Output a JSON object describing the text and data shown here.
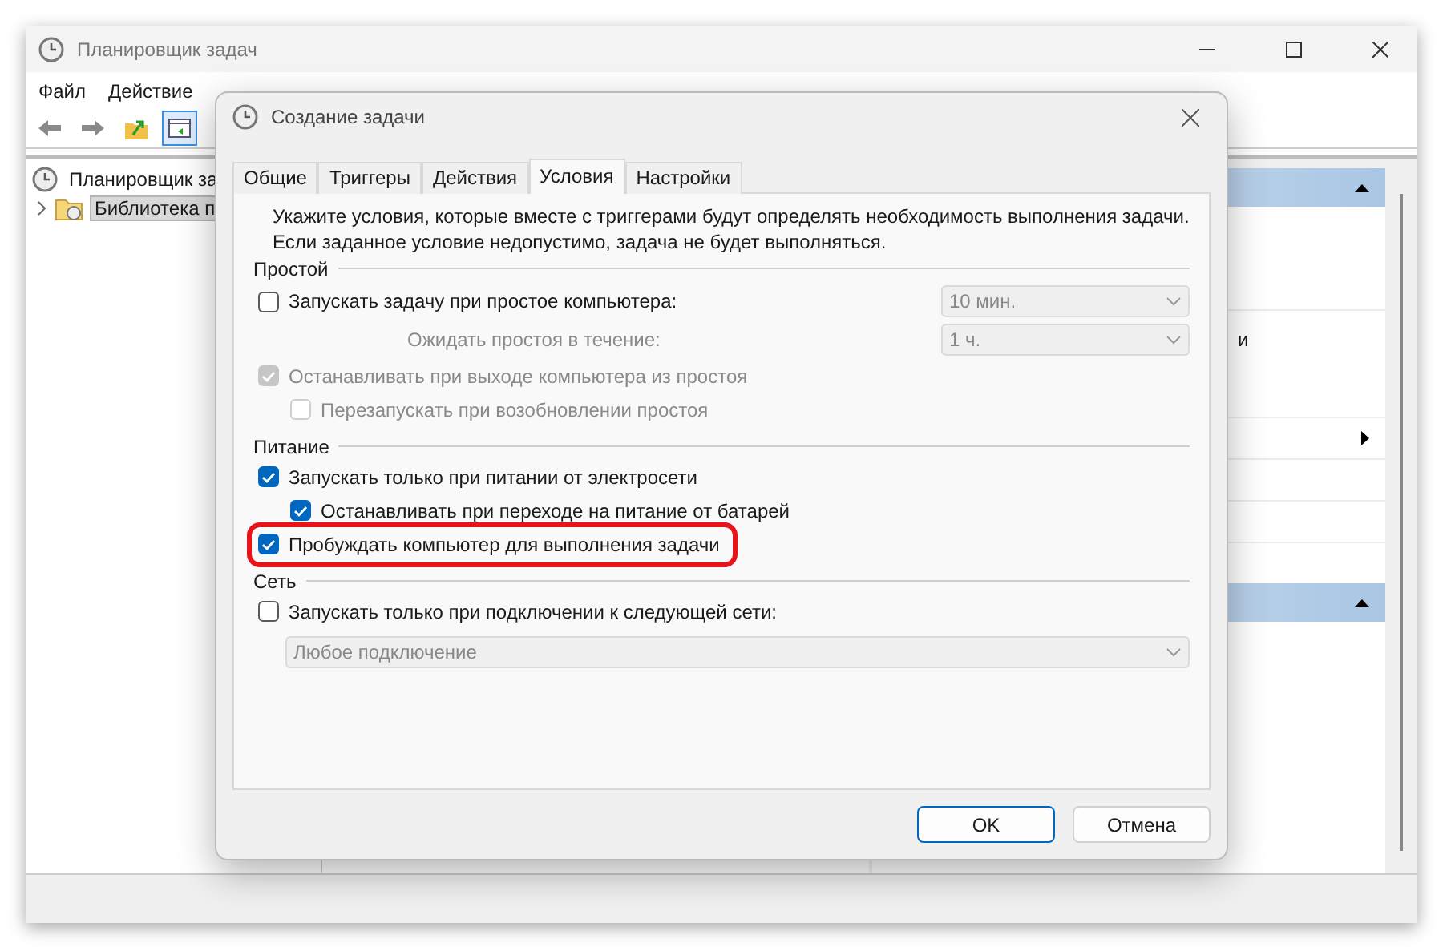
{
  "main_window": {
    "title": "Планировщик задач",
    "menu": [
      "Файл",
      "Действие"
    ],
    "tree": [
      {
        "label": "Планировщик за",
        "selected": false,
        "children": [
          {
            "label": "Библиотека п",
            "expanded": false,
            "selected": true
          }
        ]
      }
    ],
    "actions_fragment": "и"
  },
  "dialog": {
    "title": "Создание задачи",
    "tabs": [
      {
        "label": "Общие",
        "selected": false
      },
      {
        "label": "Триггеры",
        "selected": false
      },
      {
        "label": "Действия",
        "selected": false
      },
      {
        "label": "Условия",
        "selected": true
      },
      {
        "label": "Настройки",
        "selected": false
      }
    ],
    "description": "Укажите условия, которые вместе с триггерами будут определять необходимость выполнения задачи. Если заданное условие недопустимо, задача не будет выполняться.",
    "sections": [
      {
        "title": "Простой",
        "items": [
          {
            "kind": "checkbox",
            "label": "Запускать задачу при простое компьютера:",
            "checked": false,
            "disabled": false,
            "highlighted": false,
            "combo": {
              "value": "10 мин.",
              "disabled": true
            }
          },
          {
            "kind": "label",
            "label": "Ожидать простоя в течение:",
            "disabled": true,
            "combo": {
              "value": "1 ч.",
              "disabled": true
            }
          },
          {
            "kind": "checkbox",
            "label": "Останавливать при выходе компьютера из простоя",
            "checked": true,
            "disabled": true,
            "highlighted": false,
            "children": [
              {
                "kind": "checkbox",
                "label": "Перезапускать при возобновлении простоя",
                "checked": false,
                "disabled": true,
                "highlighted": false
              }
            ]
          }
        ]
      },
      {
        "title": "Питание",
        "items": [
          {
            "kind": "checkbox",
            "label": "Запускать только при питании от электросети",
            "checked": true,
            "disabled": false,
            "highlighted": false,
            "children": [
              {
                "kind": "checkbox",
                "label": "Останавливать при переходе на питание от батарей",
                "checked": true,
                "disabled": false,
                "highlighted": false
              }
            ]
          },
          {
            "kind": "checkbox",
            "label": "Пробуждать компьютер для выполнения задачи",
            "checked": true,
            "disabled": false,
            "highlighted": true
          }
        ]
      },
      {
        "title": "Сеть",
        "items": [
          {
            "kind": "checkbox",
            "label": "Запускать только при подключении к следующей сети:",
            "checked": false,
            "disabled": false,
            "highlighted": false
          },
          {
            "kind": "combo",
            "value": "Любое подключение",
            "disabled": true
          }
        ]
      }
    ],
    "buttons": [
      {
        "label": "OK",
        "default": true
      },
      {
        "label": "Отмена",
        "default": false
      }
    ]
  }
}
